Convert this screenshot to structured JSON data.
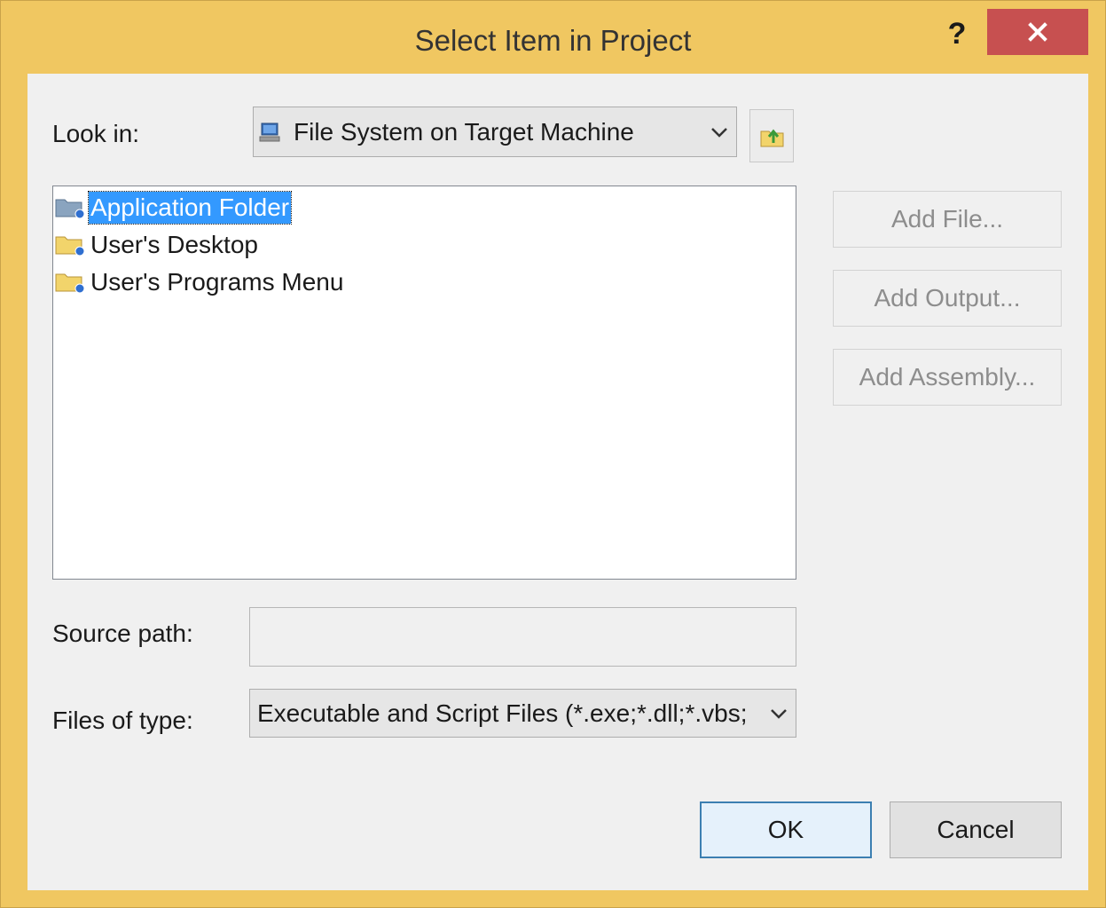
{
  "window": {
    "title": "Select Item in Project",
    "help_label": "?",
    "close_icon": "close-icon"
  },
  "look_in": {
    "label": "Look in:",
    "value": "File System on Target Machine",
    "icon": "computer-icon",
    "up_icon": "folder-up-icon"
  },
  "tree": {
    "items": [
      {
        "label": "Application Folder",
        "icon": "special-folder-icon",
        "selected": true
      },
      {
        "label": "User's Desktop",
        "icon": "folder-icon",
        "selected": false
      },
      {
        "label": "User's Programs Menu",
        "icon": "folder-icon",
        "selected": false
      }
    ]
  },
  "side_buttons": {
    "add_file": "Add File...",
    "add_output": "Add Output...",
    "add_assembly": "Add Assembly..."
  },
  "source_path": {
    "label": "Source path:",
    "value": ""
  },
  "files_of_type": {
    "label": "Files of type:",
    "value": "Executable and Script Files (*.exe;*.dll;*.vbs;"
  },
  "buttons": {
    "ok": "OK",
    "cancel": "Cancel"
  },
  "colors": {
    "title_bar": "#f0c761",
    "close_button": "#c75050",
    "selection": "#3399ff",
    "default_button_border": "#3c7fb1"
  }
}
